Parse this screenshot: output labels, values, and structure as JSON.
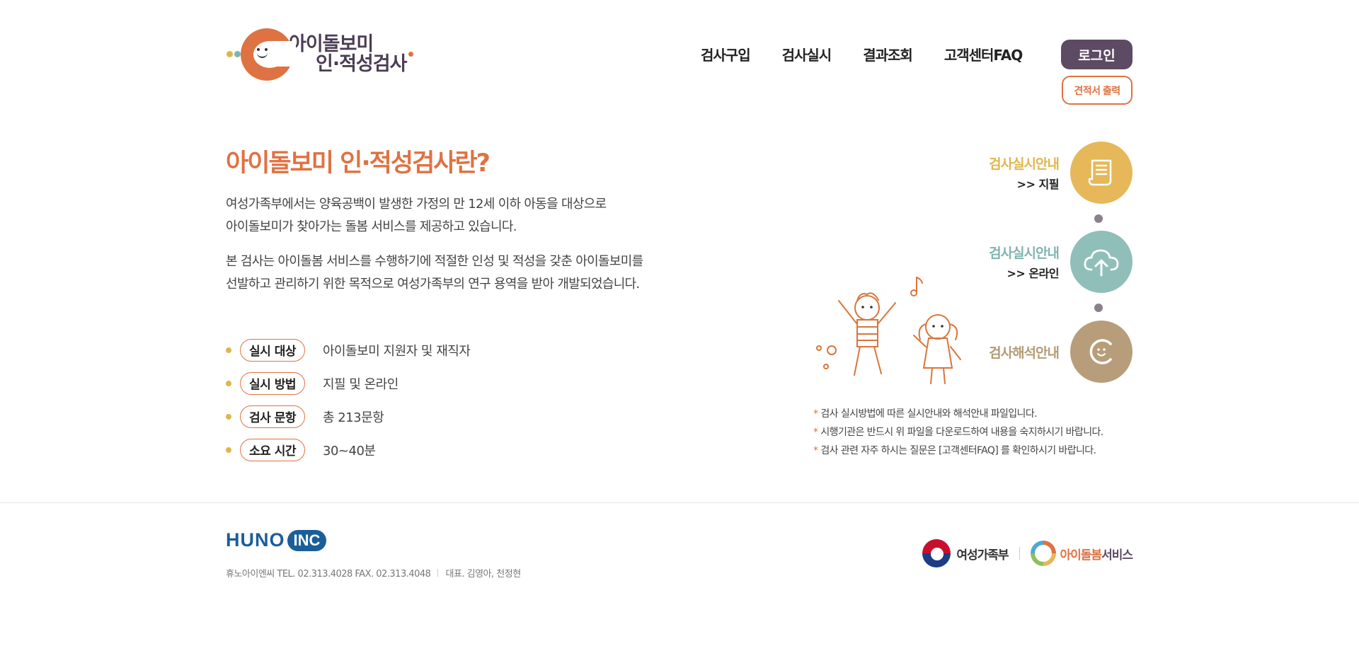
{
  "header": {
    "logo": {
      "line1": "아이돌보미",
      "line2": "인·적성검사"
    },
    "nav": [
      "검사구입",
      "검사실시",
      "결과조회",
      "고객센터FAQ"
    ],
    "login_label": "로그인",
    "estimate_label": "견적서 출력"
  },
  "intro": {
    "title": "아이돌보미 인·적성검사란?",
    "para1_line1": "여성가족부에서는 양육공백이 발생한 가정의 만 12세 이하 아동을 대상으로",
    "para1_line2": "아이돌보미가 찾아가는 돌봄 서비스를 제공하고 있습니다.",
    "para2_line1": "본 검사는 아이돌봄 서비스를 수행하기에 적절한 인성 및 적성을 갖춘 아이돌보미를",
    "para2_line2": "선발하고 관리하기 위한 목적으로 여성가족부의 연구 용역을 받아 개발되었습니다."
  },
  "info": [
    {
      "tag": "실시 대상",
      "value": "아이돌보미 지원자 및 재직자"
    },
    {
      "tag": "실시 방법",
      "value": "지필 및 온라인"
    },
    {
      "tag": "검사 문항",
      "value": "총 213문항"
    },
    {
      "tag": "소요 시간",
      "value": "30~40분"
    }
  ],
  "guides": [
    {
      "title": "검사실시안내",
      "sub": ">> 지필",
      "icon": "document-icon",
      "color": "#e6b85a"
    },
    {
      "title": "검사실시안내",
      "sub": ">> 온라인",
      "icon": "cloud-upload-icon",
      "color": "#8fbfb8"
    },
    {
      "title": "검사해석안내",
      "sub": "",
      "icon": "smile-c-icon",
      "color": "#b89d7a"
    }
  ],
  "notes": [
    "검사 실시방법에 따른 실시안내와 해석안내 파일입니다.",
    "시행기관은 반드시 위 파일을 다운로드하여 내용을 숙지하시기 바랍니다.",
    "검사 관련 자주 하시는 질문은 [고객센터FAQ] 를 확인하시기 바랍니다."
  ],
  "footer": {
    "brand_huno": "HUNO",
    "brand_inc": "INC",
    "company": "휴노아이엔씨 TEL. 02.313.4028 FAX. 02.313.4048",
    "ceo": "대표. 김영아, 천정현",
    "partner1": "여성가족부",
    "partner2_a": "아이돌봄",
    "partner2_b": "서비스"
  },
  "colors": {
    "accent": "#df7242",
    "login": "#5d4a63",
    "yellow": "#e6b85a",
    "teal": "#8fbfb8",
    "brown": "#b89d7a"
  }
}
